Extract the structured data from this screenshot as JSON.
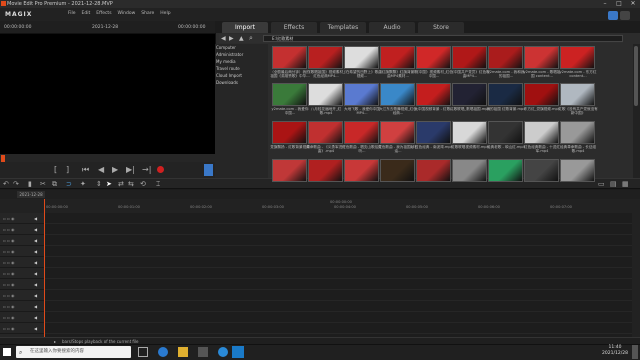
{
  "window": {
    "title": "Movie Edit Pro Premium - 2021-12-28.MVP",
    "min": "–",
    "max": "□",
    "close": "✕"
  },
  "menu": {
    "logo": "MAGIX",
    "items": [
      "File",
      "Edit",
      "Effects",
      "Window",
      "Share",
      "Help"
    ]
  },
  "preview": {
    "timecode_left": "00:00:00:00",
    "date": "2021-12-28",
    "timecode_right": "00:00:00:00"
  },
  "transport": {
    "buttons": [
      "[",
      "]",
      "⏮",
      "◀",
      "▶",
      "▶|",
      "→|"
    ]
  },
  "browser": {
    "tabs": [
      {
        "label": "Import",
        "active": true
      },
      {
        "label": "Effects",
        "active": false
      },
      {
        "label": "Templates",
        "active": false
      },
      {
        "label": "Audio",
        "active": false
      },
      {
        "label": "Store",
        "active": false
      }
    ],
    "path": "E:\\红歌素材",
    "sidebar": [
      "Computer",
      "Administrator",
      "My media",
      "Travel route",
      "Cloud Import",
      "Downloads"
    ]
  },
  "thumbs": [
    {
      "cap": "（全剧最后两分钟）我的祖国《英雄赞歌》中华...",
      "color": "#c43030"
    },
    {
      "cap": "《歌唱祖国》视频素材_红色经典MP4...",
      "color": "#b82020"
    },
    {
      "cap": "《在希望的田野上》歌曲视频...",
      "color": "#ddd"
    },
    {
      "cap": "《红旗飘飘》红旗背景歌曲MP4素材...",
      "color": "#c02020"
    },
    {
      "cap": "《中国》视频素材_红色中国...",
      "color": "#d02828"
    },
    {
      "cap": "《中国共产党员》红色歌曲MP4...",
      "color": "#b01818"
    },
    {
      "cap": "y2mate.com - 我和我的祖国...",
      "color": "#aa1c1c"
    },
    {
      "cap": "y2mate.com - 歌唱祖国 content...",
      "color": "#cc3333"
    },
    {
      "cap": "y2mate.com - 东方红 content...",
      "color": "#c22"
    },
    {
      "cap": "y2mate.com - 我爱你中国...",
      "color": "#3a7a3a"
    },
    {
      "cap": "八月桂花遍地开_红歌.mp4",
      "color": "#ddd"
    },
    {
      "cap": "大地飞歌 - 我爱你中国 MP4...",
      "color": "#5a7ad0"
    },
    {
      "cap": "大江东去歌舞视频_红色经典...",
      "color": "#3a88c8"
    },
    {
      "cap": "大中国视频背景 - 红歌...",
      "color": "#c41e1e"
    },
    {
      "cap": "红歌联唱_歌唱祖国.mp4",
      "color": "#223"
    },
    {
      "cap": "我的祖国 红歌背景.mp4",
      "color": "#1a2a44"
    },
    {
      "cap": "东方红_党旗视频.mp4",
      "color": "#a01010"
    },
    {
      "cap": "红歌《没有共产党就没有新中国》",
      "color": "#b0b8c0"
    },
    {
      "cap": "党旗飘扬 - 红歌背景视频",
      "color": "#aa1414"
    },
    {
      "cap": "革命歌曲 - 《义勇军进行曲》.mp4",
      "color": "#c03030"
    },
    {
      "cap": "红色歌曲 - 唱支山歌给党听...",
      "color": "#c82828"
    },
    {
      "cap": "红色歌曲 - 我为祖国献石油...",
      "color": "#d04040"
    },
    {
      "cap": "红色经典 - 南泥湾.mp4",
      "color": "#2a3a6a"
    },
    {
      "cap": "红歌联唱视频素材.mp4",
      "color": "#d8d8d8"
    },
    {
      "cap": "经典老歌 - 映山红.mp4",
      "color": "#333"
    },
    {
      "cap": "红色经典歌曲 - 十送红军.mp4",
      "color": "#ccc"
    },
    {
      "cap": "经典革命歌曲 - 长征组歌.mp4",
      "color": "#999"
    },
    {
      "cap": "歌唱祖国红歌合唱.mp4",
      "color": "#c03838"
    },
    {
      "cap": "革命赞歌红色经典.mp4",
      "color": "#b02020"
    },
    {
      "cap": "红歌视频素材 - 山丹丹花开.mp4",
      "color": "#c83838"
    },
    {
      "cap": "",
      "color": "#3a2a1a"
    },
    {
      "cap": "",
      "color": "#aa2a2a"
    },
    {
      "cap": "",
      "color": "#888"
    },
    {
      "cap": "",
      "color": "#2aa060"
    },
    {
      "cap": "",
      "color": "#444"
    },
    {
      "cap": "",
      "color": "#999"
    },
    {
      "cap": "",
      "color": "#7a5040"
    },
    {
      "cap": "",
      "color": "#c8c8c8"
    },
    {
      "cap": "",
      "color": "#ddd"
    },
    {
      "cap": "",
      "color": "#666"
    }
  ],
  "timeline": {
    "project_tab": "2021-12-28",
    "ruler": [
      "00:00:00:00",
      "00:00:01:00",
      "00:00:02:00",
      "00:00:03:00",
      "00:00:04:00",
      "00:00:05:00",
      "00:00:06:00",
      "00:00:07:00"
    ],
    "ruler_center": "00:00:00:00"
  },
  "status": "bars/Stops playback of the current file",
  "taskbar": {
    "search_placeholder": "在这里输入你要搜索的内容",
    "time": "11:40",
    "date": "2021/12/28"
  }
}
